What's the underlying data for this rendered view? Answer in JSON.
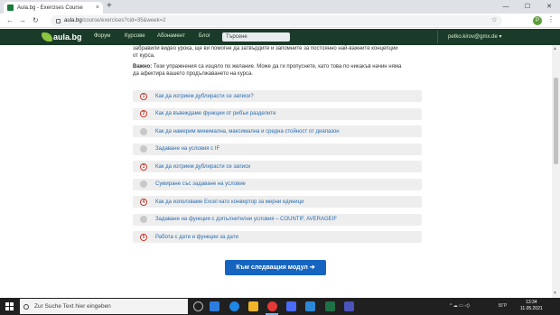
{
  "browser": {
    "tab_title": "Aula.bg - Exercises Course",
    "tab_close": "×",
    "new_tab": "+",
    "url_domain": "aula.bg",
    "url_path": "/course/exercises?cid=35&week=2",
    "minimize": "—",
    "restore": "☐",
    "close": "✕",
    "back": "←",
    "forward": "→",
    "reload": "↻",
    "profile_letter": "P",
    "menu": "⋮",
    "star": "☆"
  },
  "site": {
    "logo_text": "aula.bg",
    "nav": [
      "Форум",
      "Курсове",
      "Абонамент",
      "Блог"
    ],
    "search_placeholder": "Търсене",
    "user_email": "petko.kirov@gmx.de ▾"
  },
  "content": {
    "intro_line1": "забравили видео урока, ще ви помогне да затвърдите и запомните за постоянно най-важните концепции",
    "intro_line2": "от курса.",
    "note_label": "Важно:",
    "note_text_line1": " Тези упражнения са изцяло по желание. Може да ги пропуснете, като това по никакъв начин няма",
    "note_text_line2": "да афектира вашето продължаването на курса.",
    "exercises": [
      {
        "badge": "1",
        "label": "Как да изтрием дублирасти се записи?"
      },
      {
        "badge": "2",
        "label": "Как да въвеждаме функции от рибъи разделите"
      },
      {
        "badge": "",
        "label": "Как да намерим минимална, максимална и средна стойност от диапазон"
      },
      {
        "badge": "",
        "label": "Задаване на условия с IF"
      },
      {
        "badge": "3",
        "label": "Как да изтрием дублирасти се записи"
      },
      {
        "badge": "",
        "label": "Сумиране със задаване на условие"
      },
      {
        "badge": "4",
        "label": "Как да използваме Excel като конвертор за мерни единици"
      },
      {
        "badge": "",
        "label": "Задаване на функции с допълнителни условия – COUNTIF, AVERAGEIF"
      },
      {
        "badge": "5",
        "label": "Работа с дати и функции за дати"
      }
    ],
    "next_button": "Към следващия модул ➔"
  },
  "taskbar": {
    "search_text": "Zur Suche Text hier eingeben",
    "language": "БГР",
    "time": "13:34",
    "date": "11.05.2021",
    "tray_icons": "^ ☁ ▭ ◁)"
  },
  "colors": {
    "site_nav_bg": "#1b3b2a",
    "link": "#2a6db0",
    "badge_red": "#c0392b",
    "button_blue": "#1565c0"
  }
}
